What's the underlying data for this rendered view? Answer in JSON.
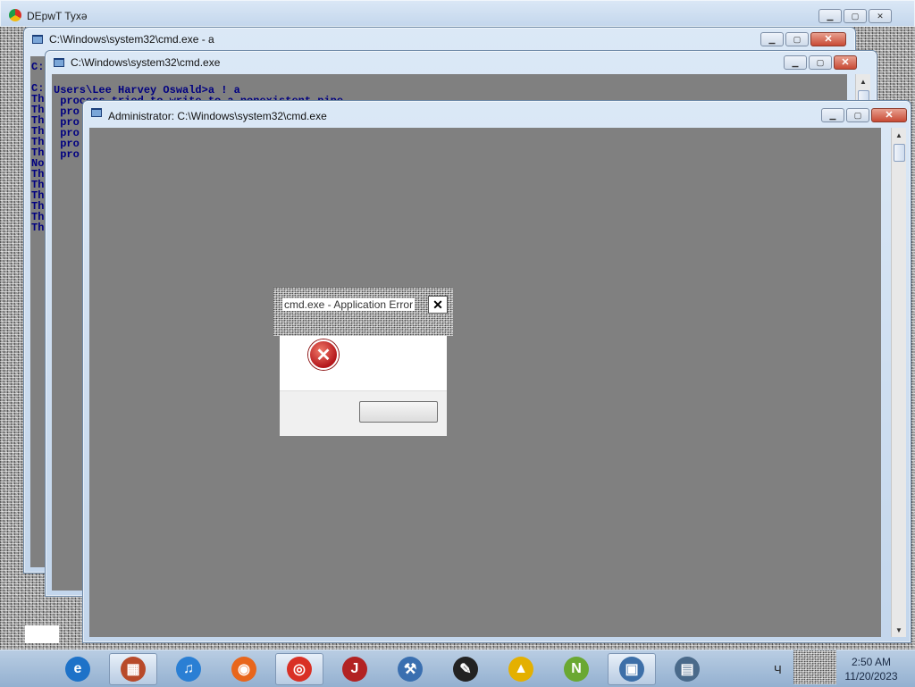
{
  "background_window": {
    "title": "DEpwT Tyxə"
  },
  "window1": {
    "title": "C:\\Windows\\system32\\cmd.exe - a",
    "console_lines": [
      "C:",
      "",
      "C:",
      "Th",
      "Th",
      "Th",
      "Th",
      "Th",
      "Th",
      "No",
      "Th",
      "Th",
      "Th",
      "Th",
      "Th",
      "Th"
    ]
  },
  "window2": {
    "title": "C:\\Windows\\system32\\cmd.exe",
    "prompt_line": "Users\\Lee Harvey Oswald>a ! a",
    "console_lines": [
      " process tried to write to a nonexistent pipe",
      " pro",
      " pro",
      " pro",
      " pro",
      " pro"
    ]
  },
  "window3": {
    "title": "Administrator: C:\\Windows\\system32\\cmd.exe"
  },
  "error_dialog": {
    "title": "cmd.exe - Application Error",
    "close_glyph": "✕",
    "icon": "error-icon",
    "icon_glyph": "✕"
  },
  "window_controls": {
    "minimize": "▁",
    "maximize": "▢",
    "close": "✕"
  },
  "scrollbar": {
    "up": "▲",
    "down": "▼"
  },
  "taskbar": {
    "items": [
      {
        "name": "internet-explorer",
        "glyph": "e",
        "color": "#1e72c8"
      },
      {
        "name": "file-manager",
        "glyph": "▦",
        "color": "#b84a2a"
      },
      {
        "name": "itunes",
        "glyph": "♫",
        "color": "#2a7fd4"
      },
      {
        "name": "firefox",
        "glyph": "◉",
        "color": "#e8661c"
      },
      {
        "name": "chrome",
        "glyph": "◎",
        "color": "#d93025"
      },
      {
        "name": "java-app",
        "glyph": "J",
        "color": "#b22222"
      },
      {
        "name": "tools-app",
        "glyph": "⚒",
        "color": "#3a6fb0"
      },
      {
        "name": "paint-app",
        "glyph": "✎",
        "color": "#222222"
      },
      {
        "name": "warning-app",
        "glyph": "▲",
        "color": "#e4b000"
      },
      {
        "name": "notepadpp",
        "glyph": "N",
        "color": "#6aa832"
      },
      {
        "name": "monitor-app",
        "glyph": "▣",
        "color": "#3d6fa8"
      },
      {
        "name": "window-app",
        "glyph": "▤",
        "color": "#4a6a8a"
      }
    ],
    "tray_text": "Ч",
    "clock_time": "2:50 AM",
    "clock_date": "11/20/2023"
  }
}
